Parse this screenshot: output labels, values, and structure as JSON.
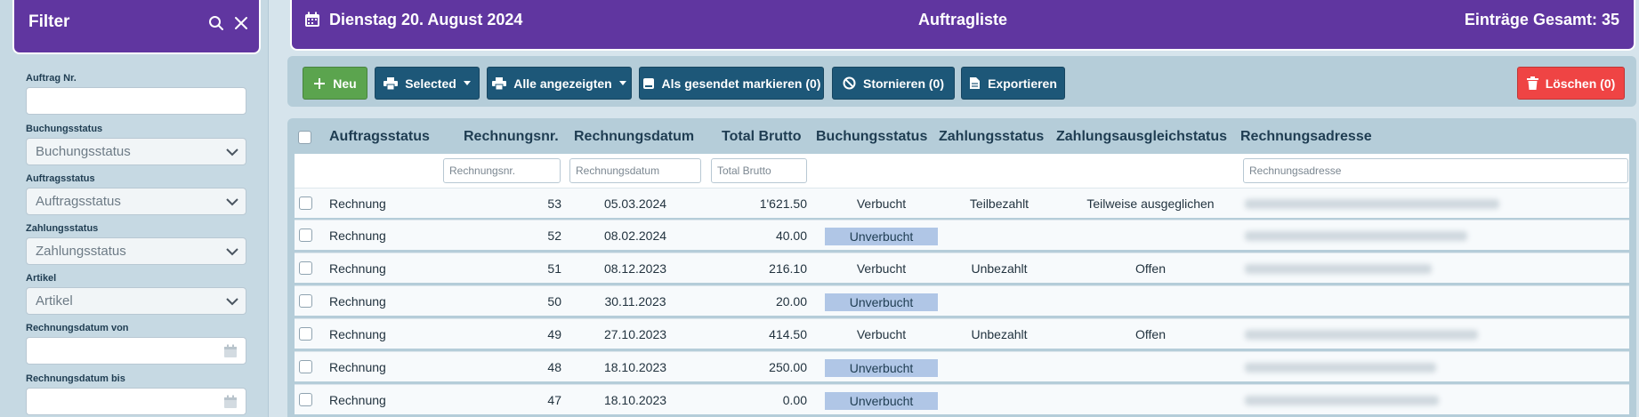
{
  "sidebar": {
    "title": "Filter",
    "icons": [
      "search-icon",
      "close-icon"
    ],
    "fields": [
      {
        "label": "Auftrag Nr.",
        "type": "text",
        "value": ""
      },
      {
        "label": "Buchungsstatus",
        "type": "select",
        "value": "Buchungsstatus"
      },
      {
        "label": "Auftragsstatus",
        "type": "select",
        "value": "Auftragsstatus"
      },
      {
        "label": "Zahlungsstatus",
        "type": "select",
        "value": "Zahlungsstatus"
      },
      {
        "label": "Artikel",
        "type": "select",
        "value": "Artikel"
      },
      {
        "label": "Rechnungsdatum von",
        "type": "date",
        "value": ""
      },
      {
        "label": "Rechnungsdatum bis",
        "type": "date",
        "value": ""
      }
    ]
  },
  "header": {
    "date": "Dienstag 20. August 2024",
    "title": "Auftragliste",
    "count": "Einträge Gesamt: 35"
  },
  "toolbar": {
    "new_label": "Neu",
    "selected_label": "Selected",
    "all_shown_label": "Alle angezeigten",
    "mark_sent_label": "Als gesendet markieren (0)",
    "cancel_label": "Stornieren (0)",
    "export_label": "Exportieren",
    "delete_label": "Löschen (0)"
  },
  "table": {
    "columns": [
      "Auftragsstatus",
      "Rechnungsnr.",
      "Rechnungsdatum",
      "Total Brutto",
      "Buchungsstatus",
      "Zahlungsstatus",
      "Zahlungsausgleichstatus",
      "Rechnungsadresse"
    ],
    "filters": {
      "rechnungsnr": "Rechnungsnr.",
      "rechnungsdatum": "Rechnungsdatum",
      "total": "Total Brutto",
      "adresse": "Rechnungsadresse"
    },
    "rows": [
      {
        "status": "Rechnung",
        "nr": "53",
        "datum": "05.03.2024",
        "total": "1'621.50",
        "buchung": "Verbucht",
        "zahlung": "Teilbezahlt",
        "ausgleich": "Teilweise ausgeglichen"
      },
      {
        "status": "Rechnung",
        "nr": "52",
        "datum": "08.02.2024",
        "total": "40.00",
        "buchung": "Unverbucht",
        "zahlung": "",
        "ausgleich": ""
      },
      {
        "status": "Rechnung",
        "nr": "51",
        "datum": "08.12.2023",
        "total": "216.10",
        "buchung": "Verbucht",
        "zahlung": "Unbezahlt",
        "ausgleich": "Offen"
      },
      {
        "status": "Rechnung",
        "nr": "50",
        "datum": "30.11.2023",
        "total": "20.00",
        "buchung": "Unverbucht",
        "zahlung": "",
        "ausgleich": ""
      },
      {
        "status": "Rechnung",
        "nr": "49",
        "datum": "27.10.2023",
        "total": "414.50",
        "buchung": "Verbucht",
        "zahlung": "Unbezahlt",
        "ausgleich": "Offen"
      },
      {
        "status": "Rechnung",
        "nr": "48",
        "datum": "18.10.2023",
        "total": "250.00",
        "buchung": "Unverbucht",
        "zahlung": "",
        "ausgleich": ""
      },
      {
        "status": "Rechnung",
        "nr": "47",
        "datum": "18.10.2023",
        "total": "0.00",
        "buchung": "Unverbucht",
        "zahlung": "",
        "ausgleich": ""
      }
    ]
  },
  "colors": {
    "header_purple": "#6036a0",
    "button_blue": "#1d5778",
    "button_green": "#5ba44e",
    "button_red": "#ef4444",
    "badge_unverbucht": "#b0c6e6"
  }
}
